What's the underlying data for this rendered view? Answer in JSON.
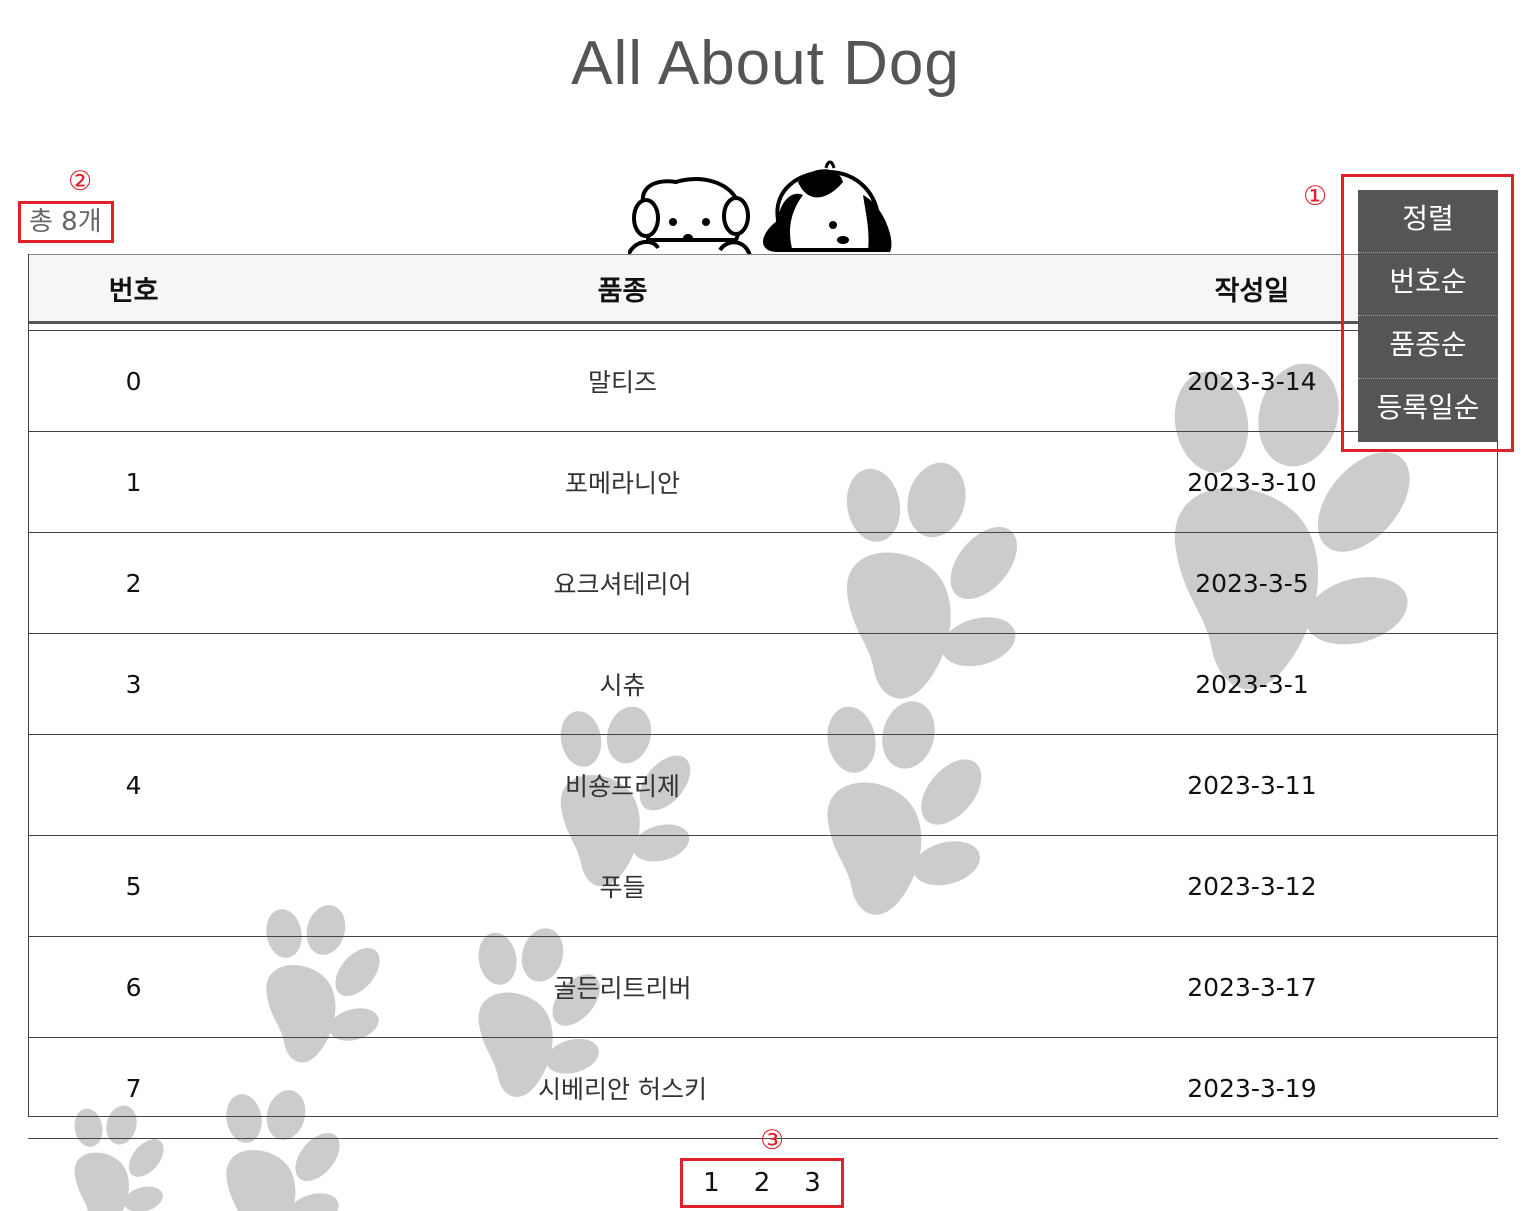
{
  "header": {
    "title": "All About Dog"
  },
  "summary": {
    "total_label": "총 8개"
  },
  "callouts": {
    "sort": "①",
    "total": "②",
    "pager": "③"
  },
  "table": {
    "headers": [
      "번호",
      "품종",
      "작성일"
    ],
    "rows": [
      {
        "no": "0",
        "breed": "말티즈",
        "date": "2023-3-14"
      },
      {
        "no": "1",
        "breed": "포메라니안",
        "date": "2023-3-10"
      },
      {
        "no": "2",
        "breed": "요크셔테리어",
        "date": "2023-3-5"
      },
      {
        "no": "3",
        "breed": "시츄",
        "date": "2023-3-1"
      },
      {
        "no": "4",
        "breed": "비숑프리제",
        "date": "2023-3-11"
      },
      {
        "no": "5",
        "breed": "푸들",
        "date": "2023-3-12"
      },
      {
        "no": "6",
        "breed": "골든리트리버",
        "date": "2023-3-17"
      },
      {
        "no": "7",
        "breed": "시베리안 허스키",
        "date": "2023-3-19"
      }
    ]
  },
  "sort_menu": {
    "title": "정렬",
    "options": [
      "번호순",
      "품종순",
      "등록일순"
    ]
  },
  "pagination": {
    "pages": [
      "1",
      "2",
      "3"
    ]
  },
  "colors": {
    "highlight": "#e0202a",
    "menu_bg": "#555555",
    "paw": "#cccccc"
  },
  "decorations": {
    "background": "paw-print-icon",
    "header_art": "two-puppies-icon"
  }
}
